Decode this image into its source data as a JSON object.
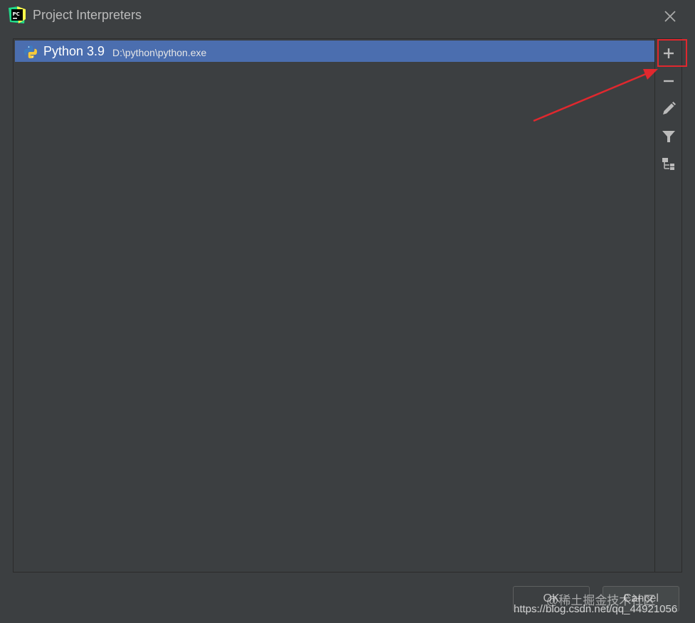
{
  "window": {
    "title": "Project Interpreters",
    "app_icon": "pycharm-icon",
    "close_icon": "close-icon"
  },
  "interpreters": [
    {
      "name": "Python 3.9",
      "path": "D:\\python\\python.exe",
      "icon": "python-icon",
      "selected": true
    }
  ],
  "toolbar": {
    "buttons": [
      {
        "icon": "plus-icon",
        "action": "add"
      },
      {
        "icon": "minus-icon",
        "action": "remove"
      },
      {
        "icon": "pencil-icon",
        "action": "edit"
      },
      {
        "icon": "filter-icon",
        "action": "filter"
      },
      {
        "icon": "tree-icon",
        "action": "show-paths"
      }
    ]
  },
  "footer": {
    "ok_label": "OK",
    "cancel_label": "Cancel"
  },
  "watermark": {
    "line1": "@稀土掘金技术社区",
    "line2": "https://blog.csdn.net/qq_44921056"
  },
  "colors": {
    "selection": "#4b6eaf",
    "highlight": "#e0282e",
    "background": "#3c3f41"
  }
}
